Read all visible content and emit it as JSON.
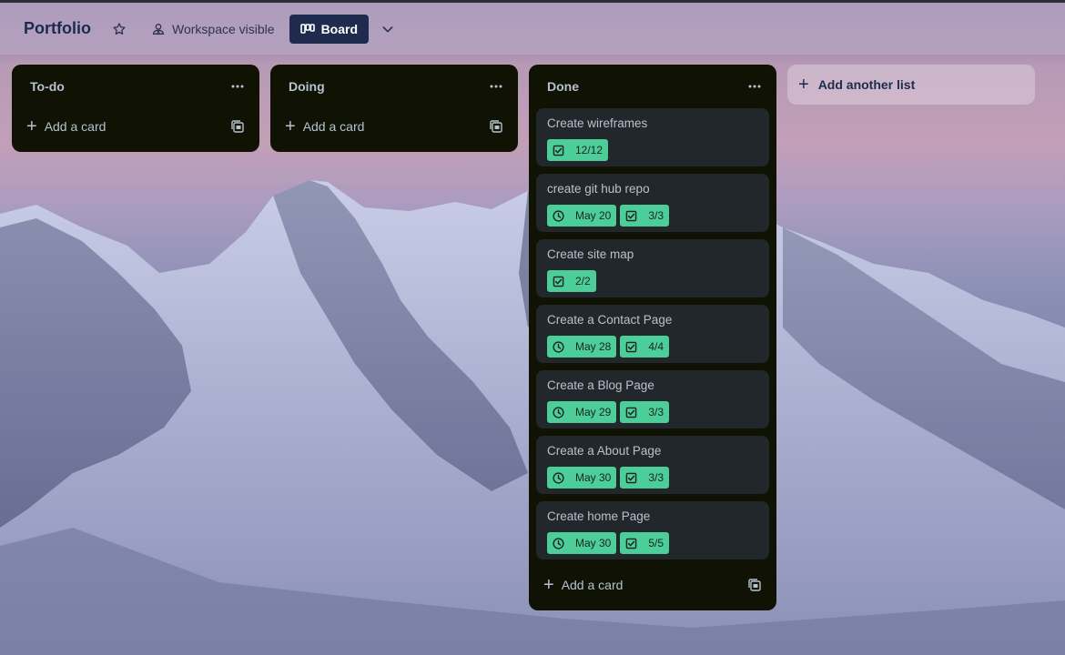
{
  "board": {
    "title": "Portfolio",
    "visibility_label": "Workspace visible",
    "view_label": "Board"
  },
  "lists": [
    {
      "title": "To-do",
      "add_card_label": "Add a card",
      "cards": []
    },
    {
      "title": "Doing",
      "add_card_label": "Add a card",
      "cards": []
    },
    {
      "title": "Done",
      "add_card_label": "Add a card",
      "cards": [
        {
          "title": "Create wireframes",
          "badges": [
            {
              "icon": "checklist-icon",
              "text": "12/12"
            }
          ]
        },
        {
          "title": "create git hub repo",
          "badges": [
            {
              "icon": "clock-icon",
              "text": "May 20"
            },
            {
              "icon": "checklist-icon",
              "text": "3/3"
            }
          ]
        },
        {
          "title": "Create site map",
          "badges": [
            {
              "icon": "checklist-icon",
              "text": "2/2"
            }
          ]
        },
        {
          "title": "Create a Contact Page",
          "badges": [
            {
              "icon": "clock-icon",
              "text": "May 28"
            },
            {
              "icon": "checklist-icon",
              "text": "4/4"
            }
          ]
        },
        {
          "title": "Create a Blog Page",
          "badges": [
            {
              "icon": "clock-icon",
              "text": "May 29"
            },
            {
              "icon": "checklist-icon",
              "text": "3/3"
            }
          ]
        },
        {
          "title": "Create a About Page",
          "badges": [
            {
              "icon": "clock-icon",
              "text": "May 30"
            },
            {
              "icon": "checklist-icon",
              "text": "3/3"
            }
          ]
        },
        {
          "title": "Create home Page",
          "badges": [
            {
              "icon": "clock-icon",
              "text": "May 30"
            },
            {
              "icon": "checklist-icon",
              "text": "5/5"
            }
          ]
        }
      ]
    }
  ],
  "add_list_label": "Add another list",
  "colors": {
    "list_bg": "#101204",
    "card_bg": "#22272b",
    "badge_complete": "#4bce97",
    "view_button": "#1e2b4f",
    "title_text": "#1d2a4f"
  }
}
